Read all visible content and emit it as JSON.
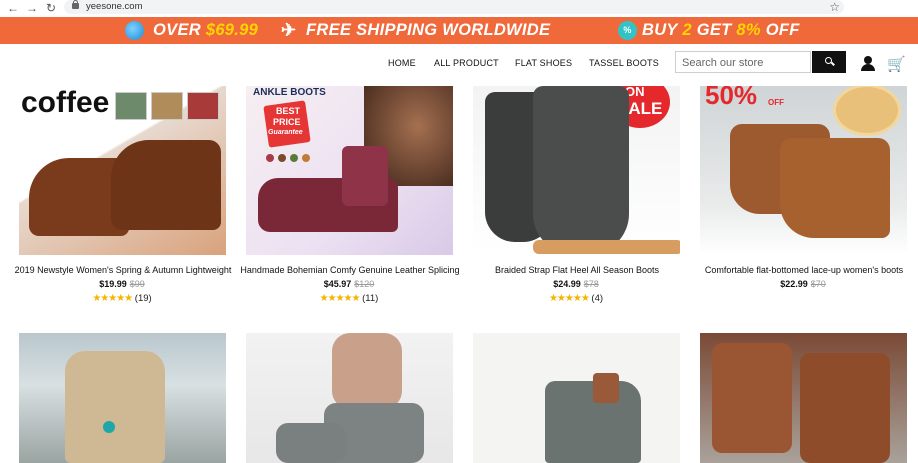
{
  "browser": {
    "url": "yeesone.com",
    "back_icon": "←",
    "forward_icon": "→",
    "reload_icon": "↻"
  },
  "promo": {
    "seg1_pre": "OVER ",
    "seg1_val": "$69.99",
    "seg2": "FREE SHIPPING WORLDWIDE",
    "seg3_pre": "BUY ",
    "seg3_num": "2",
    "seg3_mid": " GET ",
    "seg3_pct": "8%",
    "seg3_post": " OFF",
    "pct_icon": "%",
    "bg": "#f0693a",
    "highlight": "#ffd400"
  },
  "nav": {
    "items": [
      "HOME",
      "ALL PRODUCT",
      "FLAT SHOES",
      "TASSEL BOOTS"
    ]
  },
  "search": {
    "placeholder": "Search our store"
  },
  "products": [
    {
      "title": "2019 Newstyle Women's Spring & Autumn Lightweight",
      "price": "$19.99",
      "was": "$99",
      "reviews": "(19)",
      "overlay": "coffee"
    },
    {
      "title": "Handmade Bohemian Comfy Genuine Leather Splicing",
      "price": "$45.97",
      "was": "$120",
      "reviews": "(11)",
      "overlay_top": "ANKLE BOOTS",
      "overlay_badge1": "BEST",
      "overlay_badge2": "PRICE",
      "overlay_badge3": "Guarantee"
    },
    {
      "title": "Braided Strap Flat Heel All Season Boots",
      "price": "$24.99",
      "was": "$78",
      "reviews": "(4)",
      "overlay_badge1": "ON",
      "overlay_badge2": "SALE"
    },
    {
      "title": "Comfortable flat-bottomed lace-up women's boots",
      "price": "$22.99",
      "was": "$70",
      "reviews": "",
      "overlay_big": "50%",
      "overlay_small": "OFF"
    }
  ],
  "stars": "★★★★★"
}
